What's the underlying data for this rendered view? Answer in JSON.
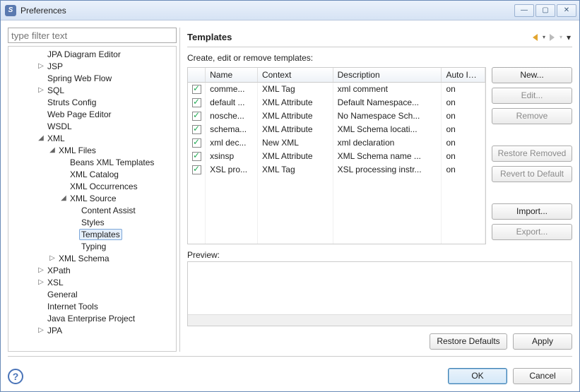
{
  "window": {
    "title": "Preferences"
  },
  "filter": {
    "placeholder": "type filter text"
  },
  "tree": {
    "items": [
      {
        "label": "JPA Diagram Editor",
        "level": 0,
        "twisty": ""
      },
      {
        "label": "JSP",
        "level": 0,
        "twisty": "▷"
      },
      {
        "label": "Spring Web Flow",
        "level": 0,
        "twisty": ""
      },
      {
        "label": "SQL",
        "level": 0,
        "twisty": "▷"
      },
      {
        "label": "Struts Config",
        "level": 0,
        "twisty": ""
      },
      {
        "label": "Web Page Editor",
        "level": 0,
        "twisty": ""
      },
      {
        "label": "WSDL",
        "level": 0,
        "twisty": ""
      },
      {
        "label": "XML",
        "level": 0,
        "twisty": "◢"
      },
      {
        "label": "XML Files",
        "level": 1,
        "twisty": "◢"
      },
      {
        "label": "Beans XML Templates",
        "level": 2,
        "twisty": ""
      },
      {
        "label": "XML Catalog",
        "level": 2,
        "twisty": ""
      },
      {
        "label": "XML Occurrences",
        "level": 2,
        "twisty": ""
      },
      {
        "label": "XML Source",
        "level": 2,
        "twisty": "◢"
      },
      {
        "label": "Content Assist",
        "level": 3,
        "twisty": ""
      },
      {
        "label": "Styles",
        "level": 3,
        "twisty": ""
      },
      {
        "label": "Templates",
        "level": 3,
        "twisty": "",
        "selected": true
      },
      {
        "label": "Typing",
        "level": 3,
        "twisty": ""
      },
      {
        "label": "XML Schema",
        "level": 1,
        "twisty": "▷"
      },
      {
        "label": "XPath",
        "level": 0,
        "twisty": "▷"
      },
      {
        "label": "XSL",
        "level": 0,
        "twisty": "▷"
      },
      {
        "label": "General",
        "level": 0,
        "twisty": ""
      },
      {
        "label": "Internet Tools",
        "level": 0,
        "twisty": ""
      },
      {
        "label": "Java Enterprise Project",
        "level": 0,
        "twisty": ""
      },
      {
        "label": "JPA",
        "level": 0,
        "twisty": "▷"
      }
    ]
  },
  "page": {
    "title": "Templates",
    "description": "Create, edit or remove templates:",
    "columns": {
      "name": "Name",
      "context": "Context",
      "description": "Description",
      "auto": "Auto Ins..."
    },
    "rows": [
      {
        "checked": true,
        "name": "comme...",
        "context": "XML Tag",
        "description": "xml comment",
        "auto": "on"
      },
      {
        "checked": true,
        "name": "default ...",
        "context": "XML Attribute",
        "description": "Default Namespace...",
        "auto": "on"
      },
      {
        "checked": true,
        "name": "nosche...",
        "context": "XML Attribute",
        "description": "No Namespace Sch...",
        "auto": "on"
      },
      {
        "checked": true,
        "name": "schema...",
        "context": "XML Attribute",
        "description": "XML Schema locati...",
        "auto": "on"
      },
      {
        "checked": true,
        "name": "xml dec...",
        "context": "New XML",
        "description": "xml declaration",
        "auto": "on"
      },
      {
        "checked": true,
        "name": "xsinsp",
        "context": "XML Attribute",
        "description": "XML Schema name ...",
        "auto": "on"
      },
      {
        "checked": true,
        "name": "XSL pro...",
        "context": "XML Tag",
        "description": "XSL processing instr...",
        "auto": "on"
      }
    ],
    "buttons": {
      "new": "New...",
      "edit": "Edit...",
      "remove": "Remove",
      "restoreRemoved": "Restore Removed",
      "revertDefault": "Revert to Default",
      "import": "Import...",
      "export": "Export..."
    },
    "previewLabel": "Preview:",
    "restoreDefaults": "Restore Defaults",
    "apply": "Apply"
  },
  "dialog": {
    "ok": "OK",
    "cancel": "Cancel"
  }
}
